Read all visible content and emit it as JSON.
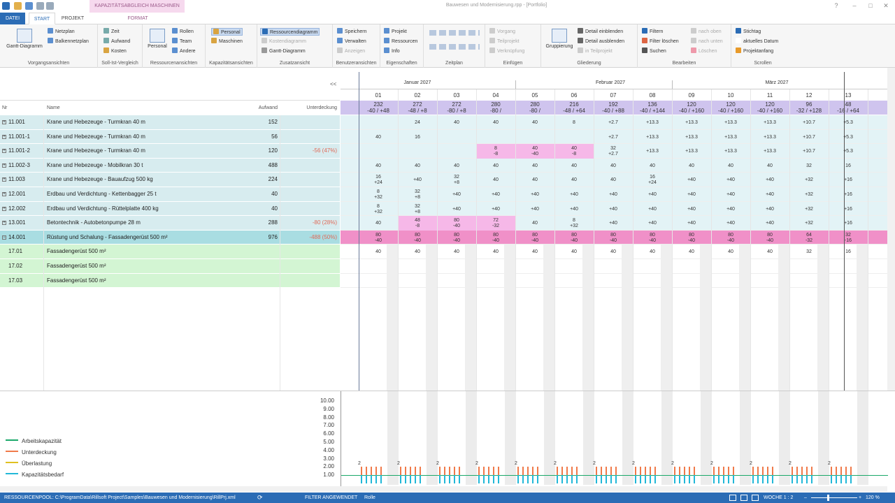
{
  "title": {
    "context_tab": "KAPAZITÄTSABGLEICH MASCHINEN",
    "document": "Bauwesen und Modernisierung.rpp - [Portfolio]"
  },
  "tabs": {
    "datei": "DATEI",
    "start": "START",
    "projekt": "PROJEKT",
    "format": "FORMAT"
  },
  "ribbon": {
    "vorgang": {
      "label": "Vorgangsansichten",
      "gantt": "Gantt-Diagramm",
      "netzplan": "Netzplan",
      "balkennetzplan": "Balkennetzplan"
    },
    "sollist": {
      "label": "Soll-Ist-Vergleich",
      "zeit": "Zeit",
      "aufwand": "Aufwand",
      "kosten": "Kosten"
    },
    "ressourcen": {
      "label": "Ressourcenansichten",
      "personal": "Personal",
      "rollen": "Rollen",
      "team": "Team",
      "andere": "Andere"
    },
    "kapazitaet": {
      "label": "Kapazitätsansichten",
      "personal": "Personal",
      "maschinen": "Maschinen"
    },
    "zusatz": {
      "label": "Zusatzansicht",
      "ressourcendiagramm": "Ressourcendiagramm",
      "kostendiagramm": "Kostendiagramm",
      "gantt": "Gantt-Diagramm"
    },
    "benutzer": {
      "label": "Benutzeransichten",
      "speichern": "Speichern",
      "verwalten": "Verwalten",
      "anzeigen": "Anzeigen"
    },
    "eigenschaften": {
      "label": "Eigenschaften",
      "projekt": "Projekt",
      "ressourcen": "Ressourcen",
      "info": "Info"
    },
    "zeitplan": {
      "label": "Zeitplan"
    },
    "einfuegen": {
      "label": "Einfügen",
      "vorgang": "Vorgang",
      "teilprojekt": "Teilprojekt",
      "verknuepfung": "Verknüpfung"
    },
    "gliederung": {
      "label": "Gliederung",
      "gruppierung": "Gruppierung",
      "detail_ein": "Detail einblenden",
      "detail_aus": "Detail ausblenden",
      "in_teilprojekt": "in Teilprojekt"
    },
    "bearbeiten": {
      "label": "Bearbeiten",
      "filtern": "Filtern",
      "filter_loeschen": "Filter löschen",
      "suchen": "Suchen",
      "nach_oben": "nach oben",
      "nach_unten": "nach unten",
      "loeschen": "Löschen"
    },
    "scrollen": {
      "label": "Scrollen",
      "stichtag": "Stichtag",
      "aktuelles_datum": "aktuelles Datum",
      "projektanfang": "Projektanfang"
    }
  },
  "table": {
    "headers": {
      "nr": "Nr",
      "name": "Name",
      "aufwand": "Aufwand",
      "unterdeckung": "Unterdeckung"
    },
    "rows": [
      {
        "nr": "11.001",
        "name": "Krane und Hebezeuge - Turmkran 40 m",
        "aufwand": "152",
        "ud": ""
      },
      {
        "nr": "11.001-1",
        "name": "Krane und Hebezeuge - Turmkran 40 m",
        "aufwand": "56",
        "ud": ""
      },
      {
        "nr": "11.001-2",
        "name": "Krane und Hebezeuge - Turmkran 40 m",
        "aufwand": "120",
        "ud": "-56 (47%)"
      },
      {
        "nr": "11.002-3",
        "name": "Krane und Hebezeuge - Mobilkran 30 t",
        "aufwand": "488",
        "ud": ""
      },
      {
        "nr": "11.003",
        "name": "Krane und Hebezeuge - Bauaufzug 500 kg",
        "aufwand": "224",
        "ud": ""
      },
      {
        "nr": "12.001",
        "name": "Erdbau und Verdichtung - Kettenbagger 25 t",
        "aufwand": "40",
        "ud": ""
      },
      {
        "nr": "12.002",
        "name": "Erdbau und Verdichtung - Rüttelplatte 400 kg",
        "aufwand": "40",
        "ud": ""
      },
      {
        "nr": "13.001",
        "name": "Betontechnik - Autobetonpumpe 28 m",
        "aufwand": "288",
        "ud": "-80 (28%)"
      },
      {
        "nr": "14.001",
        "name": "Rüstung und Schalung - Fassadengerüst 500 m²",
        "aufwand": "976",
        "ud": "-488 (50%)"
      },
      {
        "nr": "17.01",
        "name": "Fassadengerüst 500 m²",
        "aufwand": "",
        "ud": ""
      },
      {
        "nr": "17.02",
        "name": "Fassadengerüst 500 m²",
        "aufwand": "",
        "ud": ""
      },
      {
        "nr": "17.03",
        "name": "Fassadengerüst 500 m²",
        "aufwand": "",
        "ud": ""
      }
    ]
  },
  "timeline": {
    "months": [
      "Januar 2027",
      "Februar 2027",
      "März 2027"
    ],
    "weeks": [
      "01",
      "02",
      "03",
      "04",
      "05",
      "06",
      "07",
      "08",
      "09",
      "10",
      "11",
      "12",
      "13"
    ],
    "sum": [
      [
        "232",
        "-40 / +48"
      ],
      [
        "272",
        "-48 / +8"
      ],
      [
        "272",
        "-80 / +8"
      ],
      [
        "280",
        "-80 /"
      ],
      [
        "280",
        "-80 /"
      ],
      [
        "216",
        "-48 / +64"
      ],
      [
        "192",
        "-40 / +88"
      ],
      [
        "136",
        "-40 / +144"
      ],
      [
        "120",
        "-40 / +160"
      ],
      [
        "120",
        "-40 / +160"
      ],
      [
        "120",
        "-40 / +160"
      ],
      [
        "96",
        "-32 / +128"
      ],
      [
        "48",
        "-16 / +64"
      ]
    ],
    "cells": [
      [
        "",
        "24",
        "40",
        "40",
        "40",
        "8",
        "+2.7",
        "+13.3",
        "+13.3",
        "+13.3",
        "+13.3",
        "+10.7",
        "+5.3"
      ],
      [
        "40",
        "16",
        "",
        "",
        "",
        "",
        "+2.7",
        "+13.3",
        "+13.3",
        "+13.3",
        "+13.3",
        "+10.7",
        "+5.3"
      ],
      [
        "",
        "",
        "",
        "8 -8",
        "40 -40",
        "40 -8",
        "32 +2.7",
        "+13.3",
        "+13.3",
        "+13.3",
        "+13.3",
        "+10.7",
        "+5.3"
      ],
      [
        "40",
        "40",
        "40",
        "40",
        "40",
        "40",
        "40",
        "40",
        "40",
        "40",
        "40",
        "32",
        "16"
      ],
      [
        "16 +24",
        "+40",
        "32 +8",
        "40",
        "40",
        "40",
        "40",
        "16 +24",
        "+40",
        "+40",
        "+40",
        "+32",
        "+16"
      ],
      [
        "8 +32",
        "32 +8",
        "+40",
        "+40",
        "+40",
        "+40",
        "+40",
        "+40",
        "+40",
        "+40",
        "+40",
        "+32",
        "+16"
      ],
      [
        "8 +32",
        "32 +8",
        "+40",
        "+40",
        "+40",
        "+40",
        "+40",
        "+40",
        "+40",
        "+40",
        "+40",
        "+32",
        "+16"
      ],
      [
        "40",
        "48 -8",
        "80 -40",
        "72 -32",
        "40",
        "8 +32",
        "+40",
        "+40",
        "+40",
        "+40",
        "+40",
        "+32",
        "+16"
      ],
      [
        "80 -40",
        "80 -40",
        "80 -40",
        "80 -40",
        "80 -40",
        "80 -40",
        "80 -40",
        "80 -40",
        "80 -40",
        "80 -40",
        "80 -40",
        "64 -32",
        "32 -16"
      ],
      [
        "40",
        "40",
        "40",
        "40",
        "40",
        "40",
        "40",
        "40",
        "40",
        "40",
        "40",
        "32",
        "16"
      ],
      [
        "",
        "",
        "",
        "",
        "",
        "",
        "",
        "",
        "",
        "",
        "",
        "",
        ""
      ],
      [
        "",
        "",
        "",
        "",
        "",
        "",
        "",
        "",
        "",
        "",
        "",
        "",
        ""
      ]
    ]
  },
  "chart": {
    "legend": [
      "Arbeitskapazität",
      "Unterdeckung",
      "Überlastung",
      "Kapazitätsbedarf"
    ],
    "colors": {
      "arbeit": "#1aa86a",
      "unter": "#f07a4a",
      "ueber": "#e0c020",
      "bedarf": "#22b8d8"
    },
    "yticks": [
      "10.00",
      "9.00",
      "8.00",
      "7.00",
      "6.00",
      "5.00",
      "4.00",
      "3.00",
      "2.00",
      "1.00"
    ],
    "week_labels": [
      "2",
      "2",
      "2",
      "2",
      "2",
      "2",
      "2",
      "2",
      "2",
      "2",
      "2",
      "2",
      "2"
    ]
  },
  "status": {
    "pool": "RESSOURCENPOOL: C:\\ProgramData\\Rillsoft Project\\Samples\\Bauwesen und Modernisierung\\RillPrj.xml",
    "filter": "FILTER ANGEWENDET",
    "rolle": "Rolle",
    "woche": "WOCHE 1 : 2",
    "zoom": "120 %"
  }
}
